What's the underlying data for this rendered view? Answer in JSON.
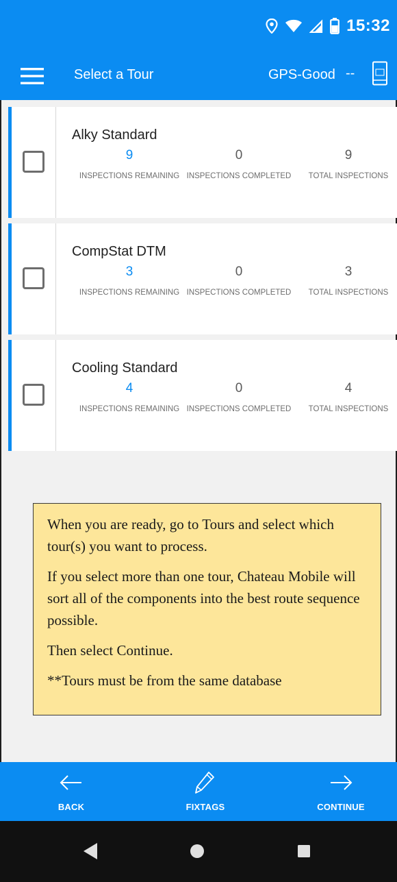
{
  "status_bar": {
    "time": "15:32",
    "icons": [
      "location-icon",
      "wifi-icon",
      "signal-icon",
      "battery-icon"
    ]
  },
  "app_bar": {
    "menu_icon": "hamburger-menu-icon",
    "title": "Select a Tour",
    "gps_status": "GPS-Good",
    "separator": "--",
    "device_icon": "device-icon"
  },
  "tours": [
    {
      "name": "Alky Standard",
      "remaining": "9",
      "completed": "0",
      "total": "9"
    },
    {
      "name": "CompStat DTM",
      "remaining": "3",
      "completed": "0",
      "total": "3"
    },
    {
      "name": "Cooling Standard",
      "remaining": "4",
      "completed": "0",
      "total": "4"
    }
  ],
  "stat_labels": {
    "remaining": "INSPECTIONS REMAINING",
    "completed": "INSPECTIONS COMPLETED",
    "total": "TOTAL INSPECTIONS"
  },
  "note": {
    "p1": "When you are ready, go to Tours and select which tour(s) you want to process.",
    "p2": "If you select more than one tour, Chateau Mobile will sort all of the components into the best route sequence possible.",
    "p3": "Then select Continue.",
    "p4": "**Tours must be from the same database"
  },
  "bottom_bar": {
    "back_label": "BACK",
    "fixtags_label": "FIXTAGS",
    "continue_label": "CONTINUE"
  },
  "colors": {
    "accent": "#0b8cf2",
    "note_background": "#fde69a",
    "nav_background": "#111111"
  }
}
